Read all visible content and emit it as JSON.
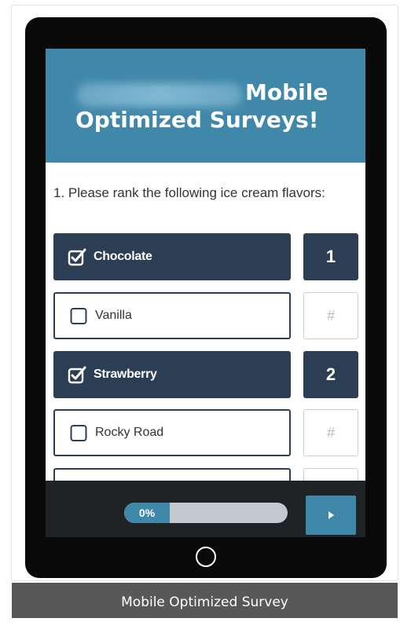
{
  "colors": {
    "header_bg": "#4088aa",
    "option_selected_bg": "#2c3e54",
    "footer_bg": "#202326",
    "caption_bg": "#585858",
    "progress_track": "#c2c9cf"
  },
  "hero": {
    "brand_text": "SurveyGizmo",
    "title_line1": "Mobile",
    "title_line2": "Optimized Surveys!"
  },
  "question": {
    "text": "1. Please rank the following ice cream flavors:"
  },
  "options": [
    {
      "label": "Chocolate",
      "checked": true,
      "rank": "1"
    },
    {
      "label": "Vanilla",
      "checked": false,
      "rank": "#"
    },
    {
      "label": "Strawberry",
      "checked": true,
      "rank": "2"
    },
    {
      "label": "Rocky Road",
      "checked": false,
      "rank": "#"
    }
  ],
  "footer": {
    "progress_label": "0%",
    "progress_value": 0,
    "next_icon": "play-arrow-icon"
  },
  "caption": "Mobile Optimized Survey"
}
